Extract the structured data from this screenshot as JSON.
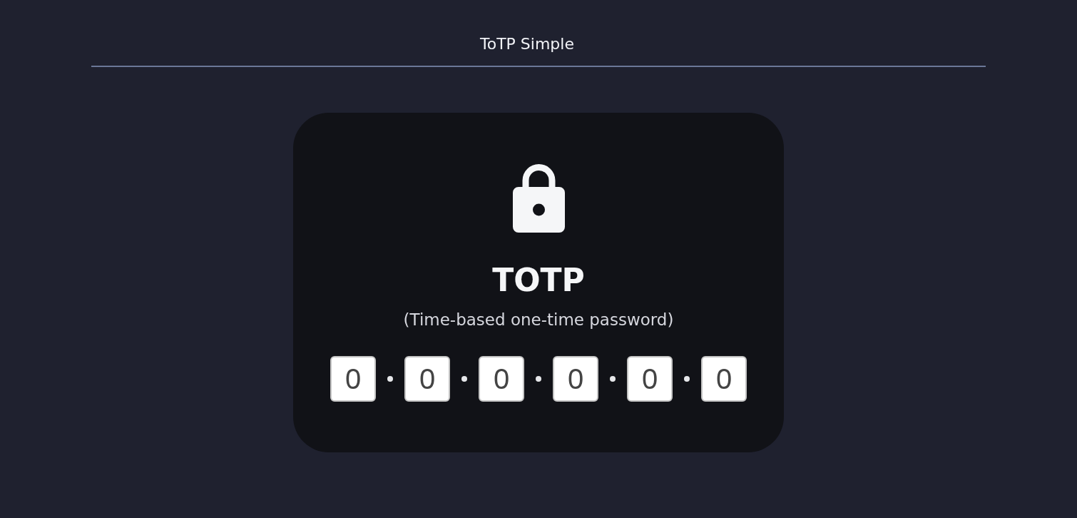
{
  "header": {
    "title": "ToTP Simple"
  },
  "card": {
    "title": "TOTP",
    "subtitle": "(Time-based one-time password)",
    "digits": [
      {
        "value": "0"
      },
      {
        "value": "0"
      },
      {
        "value": "0"
      },
      {
        "value": "0"
      },
      {
        "value": "0"
      },
      {
        "value": "0"
      }
    ]
  }
}
